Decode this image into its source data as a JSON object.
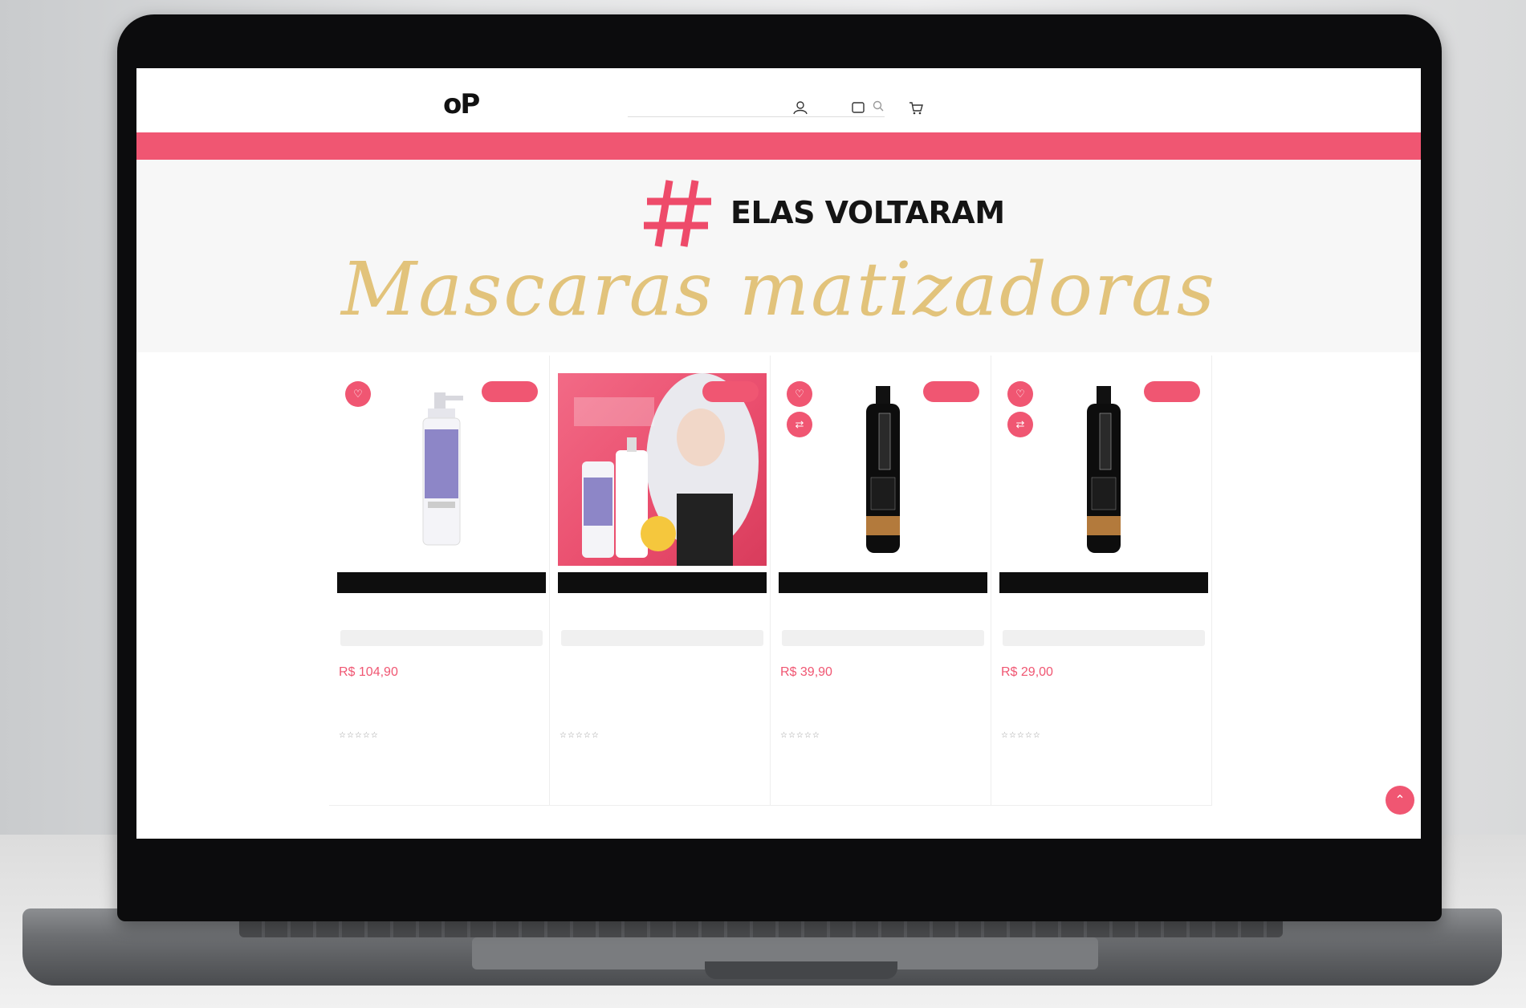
{
  "announcement": "",
  "header": {
    "logo_text": "oP",
    "logo_sub": "",
    "search_placeholder": ""
  },
  "nav": {
    "items": [
      {
        "label": ""
      },
      {
        "label": ""
      },
      {
        "label": ""
      },
      {
        "label": ""
      }
    ]
  },
  "hero": {
    "title": "ELAS VOLTARAM",
    "subtitle": "Mascaras matizadoras"
  },
  "colors": {
    "accent": "#f05672",
    "gold": "#e0be6e"
  },
  "products": [
    {
      "badge": "",
      "brand": "",
      "name": "",
      "shipping": "",
      "old_price": "",
      "price": "R$ 104,90",
      "installments": "",
      "rating_stars": "☆☆☆☆☆",
      "rating_text": "",
      "image": "white-bottle"
    },
    {
      "badge": "",
      "brand": "",
      "name": "",
      "shipping": "",
      "old_price": "",
      "price": "",
      "installments": "",
      "rating_stars": "☆☆☆☆☆",
      "rating_text": "",
      "image": "banner"
    },
    {
      "badge": "",
      "brand": "",
      "name": "",
      "shipping": "",
      "old_price": "",
      "price": "R$ 39,90",
      "installments": "",
      "rating_stars": "☆☆☆☆☆",
      "rating_text": "",
      "image": "black-bottle"
    },
    {
      "badge": "",
      "brand": "",
      "name": "",
      "shipping": "",
      "old_price": "",
      "price": "R$ 29,00",
      "installments": "",
      "rating_stars": "☆☆☆☆☆",
      "rating_text": "",
      "image": "black-bottle"
    }
  ]
}
